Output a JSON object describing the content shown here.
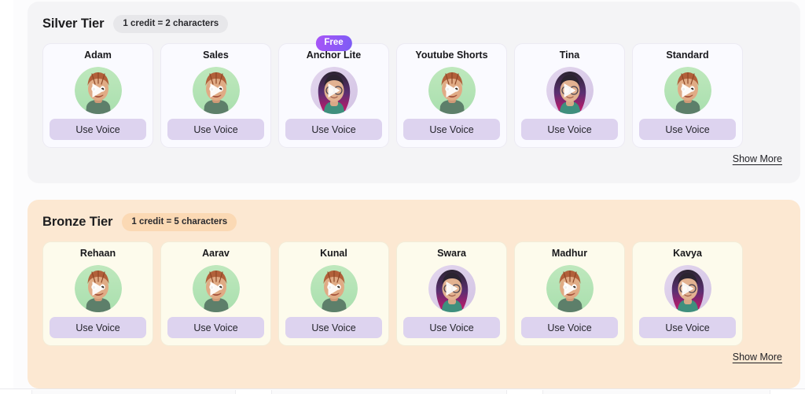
{
  "page": {
    "background": "#ffffff",
    "canvas_background": "#fcfcfd"
  },
  "tiers": [
    {
      "id": "silver",
      "title": "Silver Tier",
      "credit_chip": "1 credit = 2 characters",
      "panel_color": "#f4f4f6",
      "chip_color": "#e7e7ea",
      "card_color": "#fafaff",
      "show_more_label": "Show More",
      "voices": [
        {
          "name": "Adam",
          "avatar": "male",
          "button_label": "Use Voice",
          "badge": null
        },
        {
          "name": "Sales",
          "avatar": "male",
          "button_label": "Use Voice",
          "badge": null
        },
        {
          "name": "Anchor Lite",
          "avatar": "female",
          "button_label": "Use Voice",
          "badge": "Free"
        },
        {
          "name": "Youtube Shorts",
          "avatar": "male",
          "button_label": "Use Voice",
          "badge": null
        },
        {
          "name": "Tina",
          "avatar": "female",
          "button_label": "Use Voice",
          "badge": null
        },
        {
          "name": "Standard",
          "avatar": "male",
          "button_label": "Use Voice",
          "badge": null
        }
      ]
    },
    {
      "id": "bronze",
      "title": "Bronze Tier",
      "credit_chip": "1 credit = 5 characters",
      "panel_color": "#fce8d2",
      "chip_color": "#fbd9b4",
      "card_color": "#fdfbec",
      "show_more_label": "Show More",
      "voices": [
        {
          "name": "Rehaan",
          "avatar": "male",
          "button_label": "Use Voice",
          "badge": null
        },
        {
          "name": "Aarav",
          "avatar": "male",
          "button_label": "Use Voice",
          "badge": null
        },
        {
          "name": "Kunal",
          "avatar": "male",
          "button_label": "Use Voice",
          "badge": null
        },
        {
          "name": "Swara",
          "avatar": "female",
          "button_label": "Use Voice",
          "badge": null
        },
        {
          "name": "Madhur",
          "avatar": "male",
          "button_label": "Use Voice",
          "badge": null
        },
        {
          "name": "Kavya",
          "avatar": "female",
          "button_label": "Use Voice",
          "badge": null
        }
      ]
    }
  ],
  "icons": {
    "play": "play-triangle-icon",
    "avatar_male": "male-avatar-icon",
    "avatar_female": "female-avatar-icon"
  },
  "colors": {
    "accent_purple": "#7c5cf5",
    "badge_gradient_start": "#a855f7",
    "badge_gradient_end": "#7c5cf5",
    "use_voice_button": "#ddd3ef",
    "avatar_male_bg": "#b6e3b6",
    "avatar_female_bg": "#ded3ea"
  }
}
